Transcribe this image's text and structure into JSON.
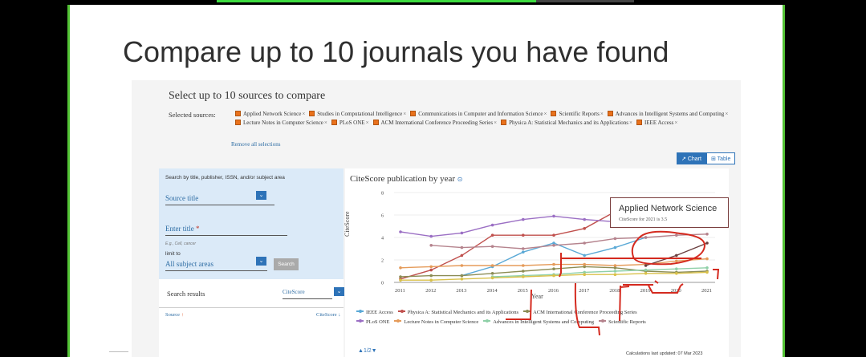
{
  "slide": {
    "title": "Compare up to 10 journals you have found"
  },
  "header": {
    "title": "Select up to 10 sources to compare",
    "selected_label": "Selected sources:",
    "remove_all": "Remove all selections"
  },
  "selected_sources": [
    "Applied Network Science",
    "Studies in Computational Intelligence",
    "Communications in Computer and Information Science",
    "Scientific Reports",
    "Advances in Intelligent Systems and Computing",
    "Lecture Notes in Computer Science",
    "PLoS ONE",
    "ACM International Conference Proceeding Series",
    "Physica A: Statistical Mechanics and its Applications",
    "IEEE Access"
  ],
  "view_toggle": {
    "chart": "Chart",
    "table": "Table",
    "active": "chart"
  },
  "search": {
    "label": "Search by title, publisher, ISSN, and/or subject area",
    "source_type": "Source title",
    "enter_title": "Enter title",
    "required_mark": "*",
    "hint": "E.g., Cell, cancer",
    "limit_label": "limit to",
    "subject": "All subject areas",
    "button": "Search"
  },
  "results": {
    "label": "Search results",
    "sort_by": "CiteScore",
    "col_source": "Source",
    "col_citescore": "CiteScore"
  },
  "chart_title": "CiteScore publication by year",
  "chart_data": {
    "type": "line",
    "ylabel": "CiteScore",
    "xlabel": "Year",
    "x": [
      2011,
      2012,
      2013,
      2014,
      2015,
      2016,
      2017,
      2018,
      2019,
      2020,
      2021
    ],
    "ylim": [
      0,
      8
    ],
    "yticks": [
      0,
      2,
      4,
      6,
      8
    ],
    "series": [
      {
        "name": "IEEE Access",
        "color": "#5aa9d6",
        "values": [
          null,
          null,
          0.6,
          1.4,
          2.7,
          3.5,
          2.4,
          3.1,
          4.0,
          null,
          null
        ]
      },
      {
        "name": "Physica A: Statistical Mechanics and its Applications",
        "color": "#c0504d",
        "values": [
          0.3,
          1.1,
          2.4,
          4.2,
          4.2,
          4.2,
          4.8,
          6.3,
          null,
          null,
          null
        ]
      },
      {
        "name": "ACM International Conference Proceeding Series",
        "color": "#8c8c54",
        "values": [
          0.5,
          0.6,
          0.6,
          0.8,
          1.0,
          1.2,
          1.4,
          1.3,
          1.0,
          0.9,
          1.0
        ]
      },
      {
        "name": "PLoS ONE",
        "color": "#9b6fc4",
        "values": [
          4.5,
          4.1,
          4.4,
          5.1,
          5.6,
          5.9,
          5.6,
          5.4,
          null,
          null,
          null
        ]
      },
      {
        "name": "Lecture Notes in Computer Science",
        "color": "#e59b5a",
        "values": [
          1.3,
          1.4,
          1.5,
          1.5,
          1.5,
          1.6,
          1.6,
          1.5,
          1.6,
          1.9,
          2.1
        ]
      },
      {
        "name": "Advances in Intelligent Systems and Computing",
        "color": "#8fd0a8",
        "values": [
          null,
          null,
          null,
          0.5,
          0.6,
          0.7,
          0.9,
          1.0,
          1.1,
          1.2,
          1.3
        ]
      },
      {
        "name": "Scientific Reports",
        "color": "#b5838d",
        "values": [
          null,
          3.3,
          3.1,
          3.2,
          3.0,
          3.3,
          3.5,
          3.9,
          4.0,
          4.2,
          4.3
        ]
      },
      {
        "name": "Applied Network Science",
        "color": "#6b3f3f",
        "values": [
          null,
          null,
          null,
          null,
          null,
          null,
          null,
          null,
          1.5,
          2.4,
          3.5
        ]
      },
      {
        "name": "Communications in Computer and Information Science",
        "color": "#d9c14a",
        "values": [
          0.2,
          0.2,
          0.3,
          0.4,
          0.5,
          0.6,
          0.7,
          0.7,
          0.8,
          0.8,
          0.9
        ]
      }
    ]
  },
  "legend": [
    {
      "label": "IEEE Access",
      "color": "#5aa9d6"
    },
    {
      "label": "Physica A: Statistical Mechanics and its Applications",
      "color": "#c0504d"
    },
    {
      "label": "ACM International Conference Proceeding Series",
      "color": "#8c8c54"
    },
    {
      "label": "PLoS ONE",
      "color": "#9b6fc4"
    },
    {
      "label": "Lecture Notes in Computer Science",
      "color": "#e59b5a"
    },
    {
      "label": "Advances in Intelligent Systems and Computing",
      "color": "#8fd0a8"
    },
    {
      "label": "Scientific Reports",
      "color": "#b5838d"
    }
  ],
  "pager": "1/2",
  "calc_note": "Calculations last updated: 07 Mar 2023",
  "tooltip": {
    "title": "Applied Network Science",
    "subtitle": "CiteScore for 2021 is 3.5"
  },
  "annotation_color": "#d42a1f"
}
